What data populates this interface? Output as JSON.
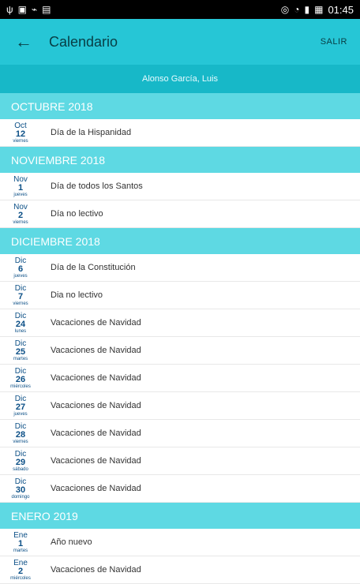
{
  "status_bar": {
    "left_icons": [
      "usb-icon",
      "image-icon",
      "battery-charge-icon",
      "document-icon"
    ],
    "right_icons": [
      "signal-icon",
      "wifi-icon",
      "cell-signal-icon",
      "battery-icon"
    ],
    "time": "01:45"
  },
  "appbar": {
    "title": "Calendario",
    "action": "SALIR"
  },
  "user": {
    "name": "Alonso García, Luis"
  },
  "sections": [
    {
      "header": "OCTUBRE 2018",
      "events": [
        {
          "month": "Oct",
          "day": "12",
          "weekday": "viernes",
          "title": "Día de la Hispanidad"
        }
      ]
    },
    {
      "header": "NOVIEMBRE 2018",
      "events": [
        {
          "month": "Nov",
          "day": "1",
          "weekday": "jueves",
          "title": "Día  de todos los Santos"
        },
        {
          "month": "Nov",
          "day": "2",
          "weekday": "viernes",
          "title": "Día no lectivo"
        }
      ]
    },
    {
      "header": "DICIEMBRE 2018",
      "events": [
        {
          "month": "Dic",
          "day": "6",
          "weekday": "jueves",
          "title": "Día de la Constitución"
        },
        {
          "month": "Dic",
          "day": "7",
          "weekday": "viernes",
          "title": "Dia  no lectivo"
        },
        {
          "month": "Dic",
          "day": "24",
          "weekday": "lunes",
          "title": "Vacaciones de Navidad"
        },
        {
          "month": "Dic",
          "day": "25",
          "weekday": "martes",
          "title": "Vacaciones de Navidad"
        },
        {
          "month": "Dic",
          "day": "26",
          "weekday": "miércoles",
          "title": "Vacaciones de Navidad"
        },
        {
          "month": "Dic",
          "day": "27",
          "weekday": "jueves",
          "title": "Vacaciones de Navidad"
        },
        {
          "month": "Dic",
          "day": "28",
          "weekday": "viernes",
          "title": "Vacaciones de Navidad"
        },
        {
          "month": "Dic",
          "day": "29",
          "weekday": "sábado",
          "title": "Vacaciones de Navidad"
        },
        {
          "month": "Dic",
          "day": "30",
          "weekday": "domingo",
          "title": "Vacaciones de Navidad"
        }
      ]
    },
    {
      "header": "ENERO 2019",
      "events": [
        {
          "month": "Ene",
          "day": "1",
          "weekday": "martes",
          "title": "Año nuevo"
        },
        {
          "month": "Ene",
          "day": "2",
          "weekday": "miércoles",
          "title": "Vacaciones de Navidad"
        }
      ]
    }
  ]
}
